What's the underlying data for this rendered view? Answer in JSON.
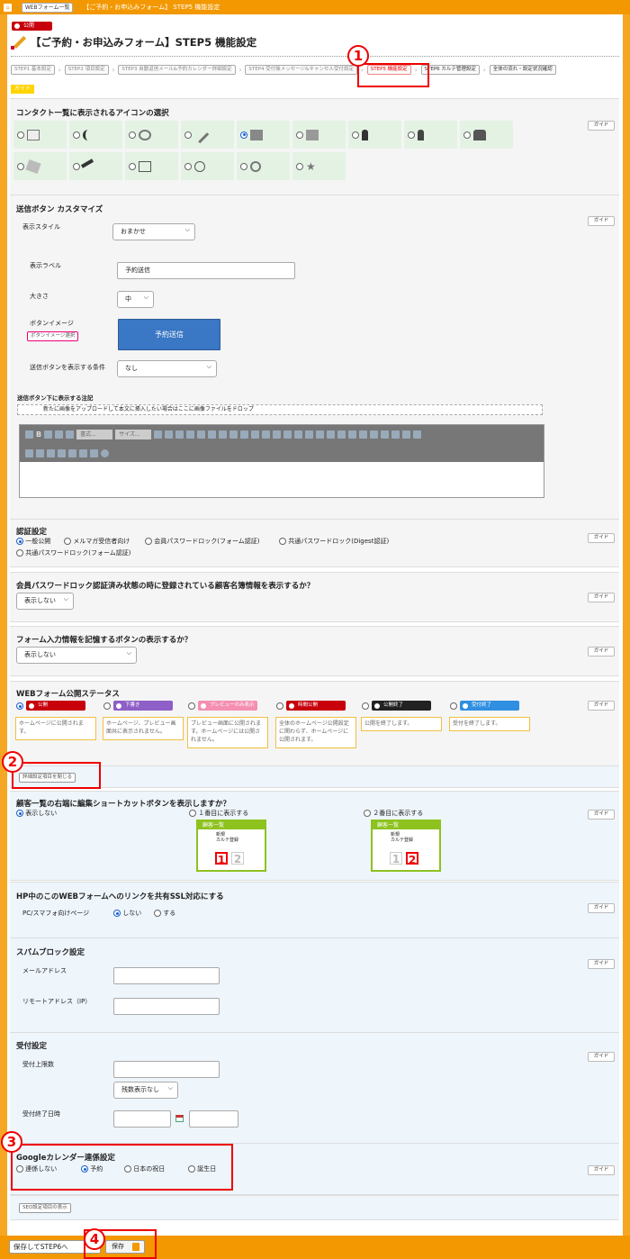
{
  "topbar": {
    "home": "⌂",
    "crumb": "WEBフォーム一覧",
    "page": "【ご予約・お申込みフォーム】 STEP5 機能設定"
  },
  "header": {
    "badge": "公開",
    "title": "【ご予約・お申込みフォーム】STEP5 機能設定"
  },
  "steps": [
    "STEP1 基本設定",
    "STEP2 項目設定",
    "STEP3 自動返信メール&予約カレンダー詳細設定",
    "STEP4 受付後メッセージ&キャンセル受付設定",
    "STEP5 機能設定",
    "STEP6 カルテ管理設定",
    "全体の流れ・設定状況確認"
  ],
  "guide_tag": "ガイド",
  "guide_label": "ガイド",
  "icon_section": {
    "title": "コンタクト一覧に表示されるアイコンの選択"
  },
  "send_button": {
    "title": "送信ボタン カスタマイズ",
    "style_label": "表示スタイル",
    "style_value": "おまかせ",
    "label_label": "表示ラベル",
    "label_value": "予約送信",
    "size_label": "大きさ",
    "size_value": "中",
    "image_label": "ボタンイメージ",
    "image_btn": "ボタンイメージ選択",
    "preview": "予約送信",
    "cond_label": "送信ボタンを表示する条件",
    "cond_value": "なし",
    "note_label": "送信ボタン下に表示する注記",
    "upload_hint": "新たに画像をアップロードして本文に挿入したい場合はここに画像ファイルをドロップ",
    "format": "書式...",
    "size": "サイズ..."
  },
  "auth": {
    "title": "認証設定",
    "options": [
      "一般公開",
      "メルマガ受信者向け",
      "会員パスワードロック(フォーム認証)",
      "共通パスワードロック(Digest認証)",
      "共通パスワードロック(フォーム認証)"
    ]
  },
  "member_info": {
    "title": "会員パスワードロック認証済み状態の時に登録されている顧客名簿情報を表示するか？",
    "value": "表示しない"
  },
  "remember": {
    "title": "フォーム入力情報を記憶するボタンの表示するか？",
    "value": "表示しない"
  },
  "status": {
    "title": "WEBフォーム公開ステータス",
    "items": [
      {
        "label": "公開",
        "note": "ホームページに公開されます。",
        "color": "#c7000b"
      },
      {
        "label": "下書き",
        "note": "ホームページ、プレビュー画面共に表示されません。",
        "color": "#8e5fc7"
      },
      {
        "label": "プレビューのみ表示",
        "note": "プレビュー画面に公開されます。ホームページには公開されません。",
        "color": "#f48fb1"
      },
      {
        "label": "時間公開",
        "note": "全体のホームページ公開設定に関わらず、ホームページに公開されます。",
        "color": "#c7000b"
      },
      {
        "label": "公開終了",
        "note": "公開を終了します。",
        "color": "#222222"
      },
      {
        "label": "受付終了",
        "note": "受付を終了します。",
        "color": "#2f8fe0"
      }
    ]
  },
  "detail_toggle": "詳細設定項目を閉じる",
  "shortcut": {
    "title": "顧客一覧の右端に編集ショートカットボタンを表示しますか？",
    "options": [
      "表示しない",
      "１番目に表示する",
      "２番目に表示する"
    ],
    "thumb_title": "顧客一覧",
    "thumb_btn1": "新規",
    "thumb_btn2": "カルテ登録"
  },
  "ssl": {
    "title": "HP中のこのWEBフォームへのリンクを共有SSL対応にする",
    "label": "PC/スマフォ向けページ",
    "opt_no": "しない",
    "opt_yes": "する"
  },
  "spam": {
    "title": "スパムブロック設定",
    "mail": "メールアドレス",
    "ip": "リモートアドレス（IP）"
  },
  "reception": {
    "title": "受付設定",
    "limit": "受付上限数",
    "remain": "残数表示なし",
    "end": "受付終了日時"
  },
  "gcal": {
    "title": "Googleカレンダー連係設定",
    "options": [
      "連係しない",
      "予約",
      "日本の祝日",
      "誕生日"
    ]
  },
  "seo_toggle": "SEO設定項目の表示",
  "footer": {
    "save_next": "保存してSTEP6へ",
    "save": "保存"
  },
  "callouts": [
    "1",
    "2",
    "3",
    "4"
  ]
}
